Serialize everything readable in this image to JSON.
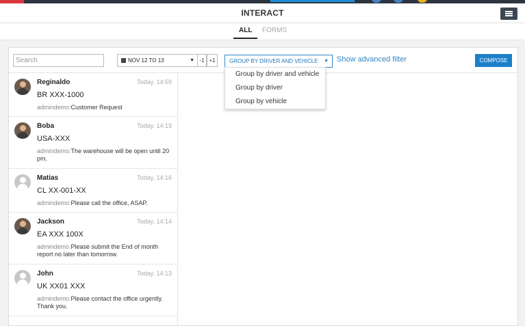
{
  "header": {
    "title": "INTERACT"
  },
  "tabs": [
    {
      "label": "ALL"
    },
    {
      "label": "FORMS"
    }
  ],
  "toolbar": {
    "search_placeholder": "Search",
    "date_range": "NOV 12 TO 13",
    "minus_label": "-1",
    "plus_label": "+1",
    "group_selected": "GROUP BY DRIVER AND VEHICLE",
    "advanced_filter": "Show advanced filter",
    "compose": "COMPOSE"
  },
  "group_options": [
    "Group by driver and vehicle",
    "Group by driver",
    "Group by vehicle"
  ],
  "messages": [
    {
      "name": "Reginaldo",
      "time": "Today, 14:59",
      "vehicle": "BR XXX-1000",
      "sender": "admindemo:",
      "text": "Customer Request"
    },
    {
      "name": "Boba",
      "time": "Today, 14:19",
      "vehicle": "USA-XXX",
      "sender": "admindemo:",
      "text": "The warehouse will be open until 20 pm."
    },
    {
      "name": "Matias",
      "time": "Today, 14:16",
      "vehicle": "CL XX-001-XX",
      "sender": "admindemo:",
      "text": "Please call the office, ASAP."
    },
    {
      "name": "Jackson",
      "time": "Today, 14:14",
      "vehicle": "EA XXX 100X",
      "sender": "admindemo:",
      "text": "Please submit the End of month report no later than tomorrow."
    },
    {
      "name": "John",
      "time": "Today, 14:13",
      "vehicle": "UK XX01 XXX",
      "sender": "admindemo:",
      "text": "Please contact the office urgently. Thank you."
    }
  ],
  "colors": {
    "accent": "#1c7fc9",
    "topbar": "#2d3540",
    "brand_red": "#d9363e"
  }
}
